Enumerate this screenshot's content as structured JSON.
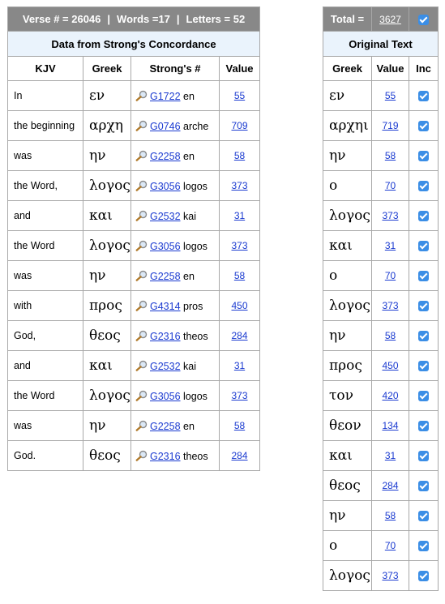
{
  "left": {
    "header": {
      "verse": "Verse # = 26046",
      "sep": "|",
      "words": "Words =17",
      "letters": "Letters = 52"
    },
    "subheader": "Data from Strong's Concordance",
    "columns": [
      "KJV",
      "Greek",
      "Strong's #",
      "Value"
    ],
    "rows": [
      {
        "kjv": "In",
        "greek": "εν",
        "strong": "G1722",
        "translit": "en",
        "value": "55"
      },
      {
        "kjv": "the beginning",
        "greek": "αρχη",
        "strong": "G0746",
        "translit": "arche",
        "value": "709"
      },
      {
        "kjv": "was",
        "greek": "ην",
        "strong": "G2258",
        "translit": "en",
        "value": "58"
      },
      {
        "kjv": "the Word,",
        "greek": "λογος",
        "strong": "G3056",
        "translit": "logos",
        "value": "373"
      },
      {
        "kjv": "and",
        "greek": "και",
        "strong": "G2532",
        "translit": "kai",
        "value": "31"
      },
      {
        "kjv": "the Word",
        "greek": "λογος",
        "strong": "G3056",
        "translit": "logos",
        "value": "373"
      },
      {
        "kjv": "was",
        "greek": "ην",
        "strong": "G2258",
        "translit": "en",
        "value": "58"
      },
      {
        "kjv": "with",
        "greek": "προς",
        "strong": "G4314",
        "translit": "pros",
        "value": "450"
      },
      {
        "kjv": "God,",
        "greek": "θεος",
        "strong": "G2316",
        "translit": "theos",
        "value": "284"
      },
      {
        "kjv": "and",
        "greek": "και",
        "strong": "G2532",
        "translit": "kai",
        "value": "31"
      },
      {
        "kjv": "the Word",
        "greek": "λογος",
        "strong": "G3056",
        "translit": "logos",
        "value": "373"
      },
      {
        "kjv": "was",
        "greek": "ην",
        "strong": "G2258",
        "translit": "en",
        "value": "58"
      },
      {
        "kjv": "God.",
        "greek": "θεος",
        "strong": "G2316",
        "translit": "theos",
        "value": "284"
      }
    ]
  },
  "right": {
    "total_label": "Total =",
    "total_value": "3627",
    "subheader": "Original Text",
    "columns": [
      "Greek",
      "Value",
      "Inc"
    ],
    "rows": [
      {
        "greek": "εν",
        "value": "55"
      },
      {
        "greek": "αρχηι",
        "value": "719"
      },
      {
        "greek": "ην",
        "value": "58"
      },
      {
        "greek": "ο",
        "value": "70"
      },
      {
        "greek": "λογος",
        "value": "373"
      },
      {
        "greek": "και",
        "value": "31"
      },
      {
        "greek": "ο",
        "value": "70"
      },
      {
        "greek": "λογος",
        "value": "373"
      },
      {
        "greek": "ην",
        "value": "58"
      },
      {
        "greek": "προς",
        "value": "450"
      },
      {
        "greek": "τον",
        "value": "420"
      },
      {
        "greek": "θεον",
        "value": "134"
      },
      {
        "greek": "και",
        "value": "31"
      },
      {
        "greek": "θεος",
        "value": "284"
      },
      {
        "greek": "ην",
        "value": "58"
      },
      {
        "greek": "ο",
        "value": "70"
      },
      {
        "greek": "λογος",
        "value": "373"
      }
    ]
  },
  "colors": {
    "header_gray": "#888888",
    "subheader_blue": "#eaf3fc",
    "link_blue": "#1a3ad0",
    "checkbox_blue": "#3b8ee6"
  },
  "icons": {
    "strongs_lookup": "magnifier-icon",
    "include": "checkbox-checked-icon"
  }
}
